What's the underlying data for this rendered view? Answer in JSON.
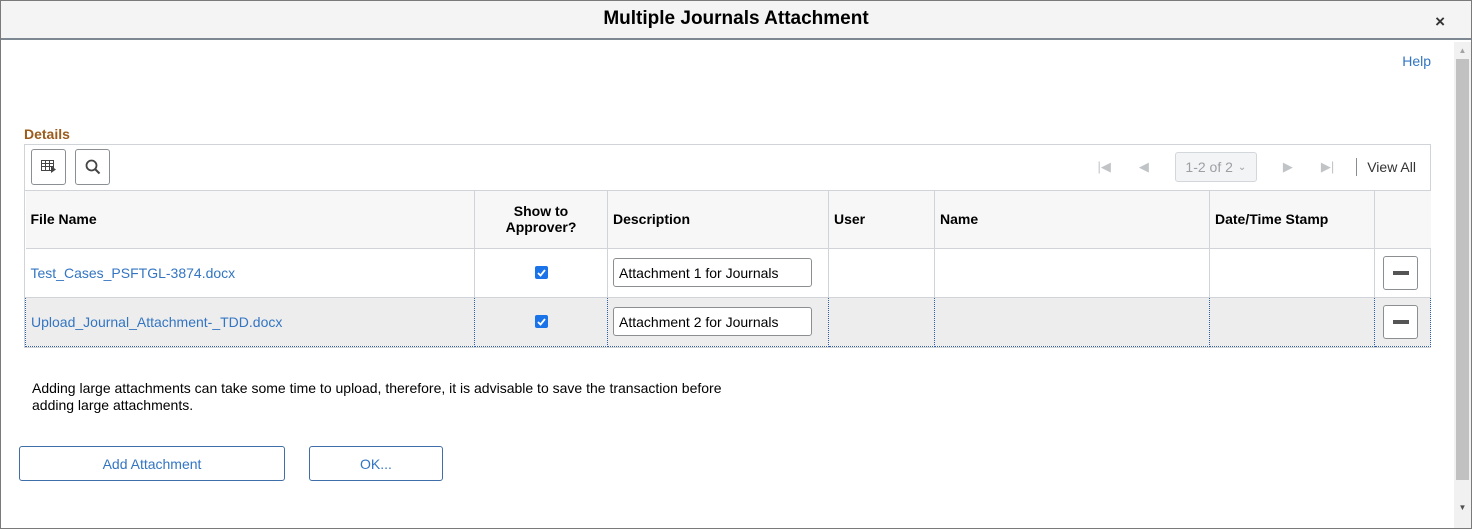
{
  "dialog": {
    "title": "Multiple Journals Attachment",
    "close_label": "×",
    "help_label": "Help"
  },
  "details": {
    "section_title": "Details",
    "toolbar": {
      "personalize_icon": "grid-personalize-icon",
      "search_icon": "search-icon",
      "pagination": {
        "first_icon": "first-page-icon",
        "prev_icon": "previous-page-icon",
        "range_label": "1-2 of 2",
        "next_icon": "next-page-icon",
        "last_icon": "last-page-icon",
        "view_all_label": "View All"
      }
    },
    "columns": {
      "file_name": "File Name",
      "show_to_approver": "Show to Approver?",
      "description": "Description",
      "user": "User",
      "name": "Name",
      "date_time_stamp": "Date/Time Stamp"
    },
    "rows": [
      {
        "file_name": "Test_Cases_PSFTGL-3874.docx",
        "show_to_approver": true,
        "description": "Attachment 1 for Journals",
        "user": "",
        "name": "",
        "date_time_stamp": "",
        "selected": false
      },
      {
        "file_name": "Upload_Journal_Attachment-_TDD.docx",
        "show_to_approver": true,
        "description": "Attachment 2 for Journals",
        "user": "",
        "name": "",
        "date_time_stamp": "",
        "selected": true
      }
    ]
  },
  "note": "Adding large attachments can take some time to upload, therefore, it is advisable to save the transaction before adding large attachments.",
  "buttons": {
    "add_attachment": "Add Attachment",
    "ok": "OK..."
  },
  "colors": {
    "link": "#3375c2",
    "section_title": "#9a5b1d",
    "checkbox": "#1a73e8",
    "selected_row_bg": "#ededed"
  }
}
